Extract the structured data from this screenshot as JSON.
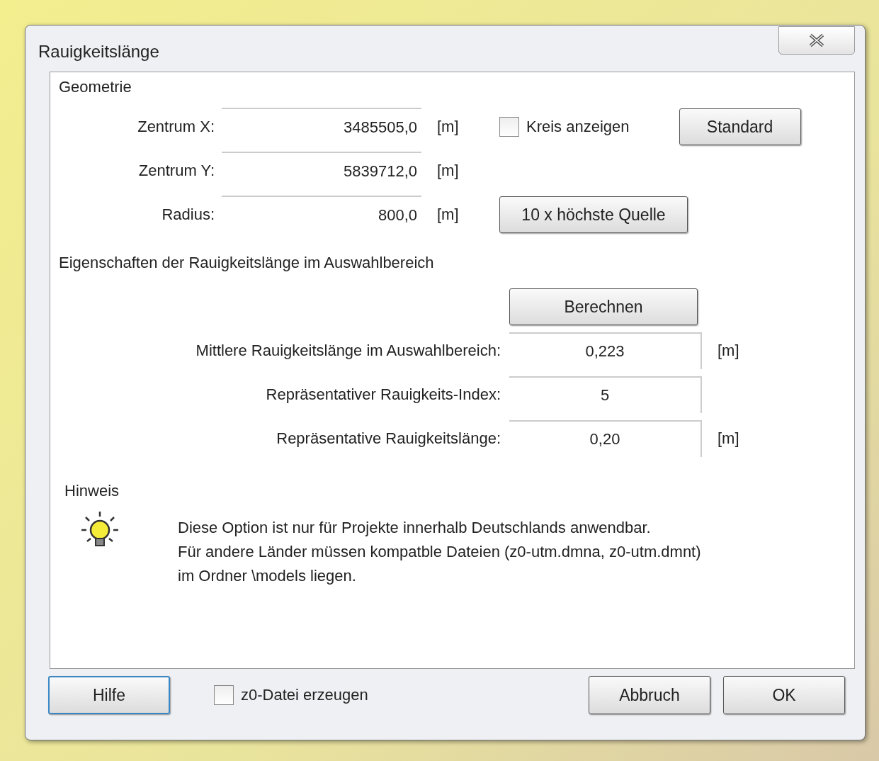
{
  "window": {
    "title": "Rauigkeitslänge"
  },
  "geometry": {
    "title": "Geometrie",
    "fields": [
      {
        "label": "Zentrum X:",
        "value": "3485505,0",
        "unit": "[m]"
      },
      {
        "label": "Zentrum Y:",
        "value": "5839712,0",
        "unit": "[m]"
      },
      {
        "label": "Radius:",
        "value": "800,0",
        "unit": "[m]"
      }
    ],
    "show_circle": {
      "label": "Kreis anzeigen",
      "checked": false
    },
    "standard_button": "Standard",
    "highest_source_button": "10 x höchste Quelle"
  },
  "properties": {
    "title": "Eigenschaften der Rauigkeitslänge im Auswahlbereich",
    "calculate_button": "Berechnen",
    "results": [
      {
        "label": "Mittlere Rauigkeitslänge im Auswahlbereich:",
        "value": "0,223",
        "unit": "[m]"
      },
      {
        "label": "Repräsentativer Rauigkeits-Index:",
        "value": "5"
      },
      {
        "label": "Repräsentative Rauigkeitslänge:",
        "value": "0,20",
        "unit": "[m]"
      }
    ]
  },
  "note": {
    "title": "Hinweis",
    "lines": [
      "Diese Option ist nur für Projekte innerhalb Deutschlands anwendbar.",
      "Für andere Länder müssen kompatble Dateien (z0-utm.dmna, z0-utm.dmnt)",
      "im Ordner \\models liegen."
    ]
  },
  "footer": {
    "help_button": "Hilfe",
    "create_file": {
      "label": "z0-Datei erzeugen",
      "checked": false
    },
    "buttons": [
      "Abbruch",
      "OK"
    ]
  }
}
